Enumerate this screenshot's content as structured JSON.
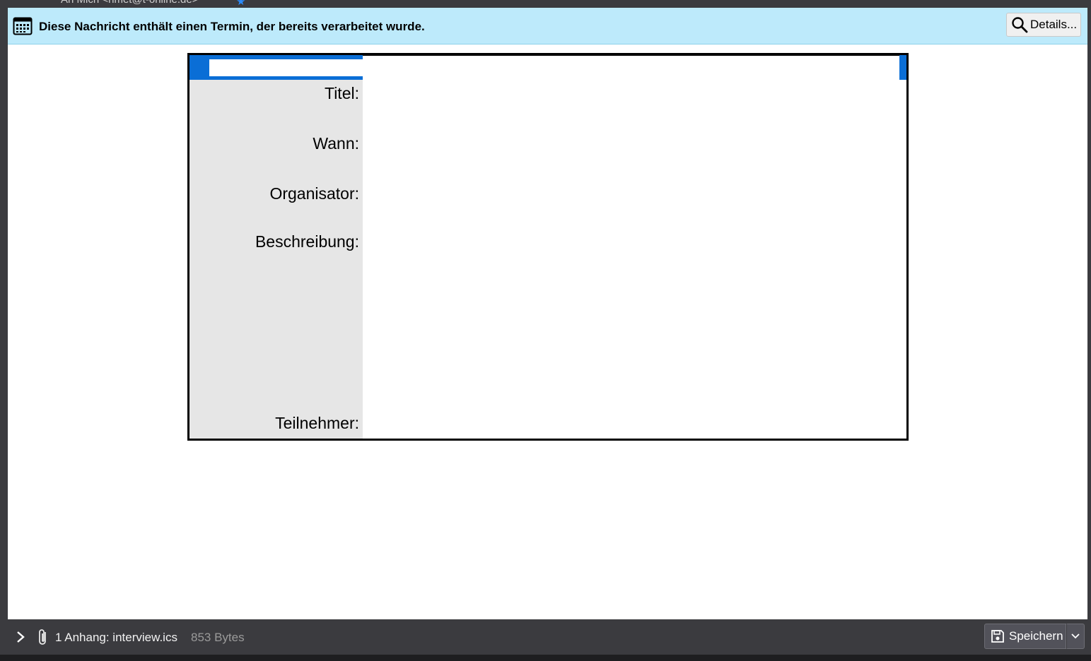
{
  "header_strip": {
    "text": "An  Mich <nmet@t-online.de>"
  },
  "notification": {
    "message": "Diese Nachricht enthält einen Termin, der bereits verarbeitet wurde.",
    "details_label": "Details..."
  },
  "invitation": {
    "labels": {
      "title": "Titel:",
      "when": "Wann:",
      "organizer": "Organisator:",
      "description": "Beschreibung:",
      "attendees": "Teilnehmer:"
    },
    "accent_color": "#0a6ed6"
  },
  "attachments": {
    "summary": "1 Anhang: interview.ics",
    "size": "853 Bytes",
    "save_label": "Speichern"
  },
  "icons": {
    "calendar": "calendar-icon",
    "search": "search-icon",
    "expand": "chevron-right-icon",
    "attachment": "paperclip-icon",
    "save": "save-icon",
    "dropdown": "chevron-down-icon"
  }
}
